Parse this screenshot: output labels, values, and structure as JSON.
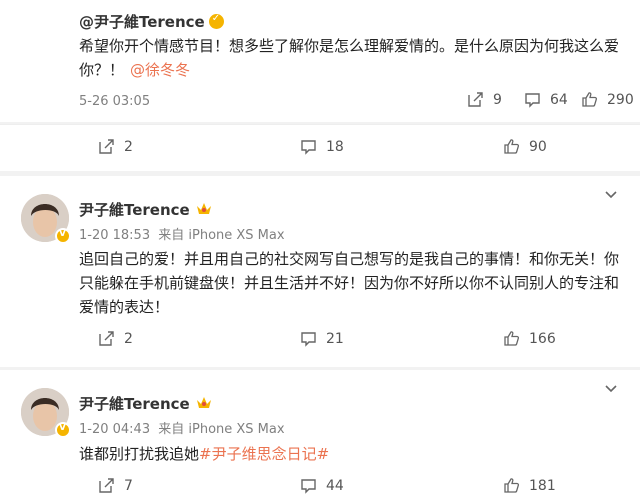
{
  "post1": {
    "author": "@尹子維Terence",
    "text_main": "希望你开个情感节目！想多些了解你是怎么理解爱情的。是什么原因为何我这么爱你？！",
    "mention": "@徐冬冬",
    "time": "5-26 03:05",
    "reposts": "9",
    "comments": "64",
    "likes": "290"
  },
  "bar1": {
    "reposts": "2",
    "comments": "18",
    "likes": "90"
  },
  "post2": {
    "author": "尹子維Terence",
    "time": "1-20 18:53",
    "source": "来自 iPhone XS Max",
    "text": "追回自己的爱！并且用自己的社交网写自己想写的是我自己的事情！和你无关！你只能躲在手机前键盘侠！并且生活并不好！因为你不好所以你不认同别人的专注和爱情的表达！",
    "reposts": "2",
    "comments": "21",
    "likes": "166"
  },
  "post3": {
    "author": "尹子維Terence",
    "time": "1-20 04:43",
    "source": "来自 iPhone XS Max",
    "text_main": "谁都别打扰我追她",
    "hashtag": "#尹子维思念日记#",
    "reposts": "7",
    "comments": "44",
    "likes": "181"
  },
  "colors": {
    "link": "#eb7350",
    "vip": "#f5b400",
    "meta": "#808080"
  },
  "icons": {
    "repost": "repost-icon",
    "comment": "comment-icon",
    "like": "like-icon",
    "verified": "verified-badge-icon",
    "crown": "vip-crown-icon",
    "more": "chevron-down-icon"
  }
}
